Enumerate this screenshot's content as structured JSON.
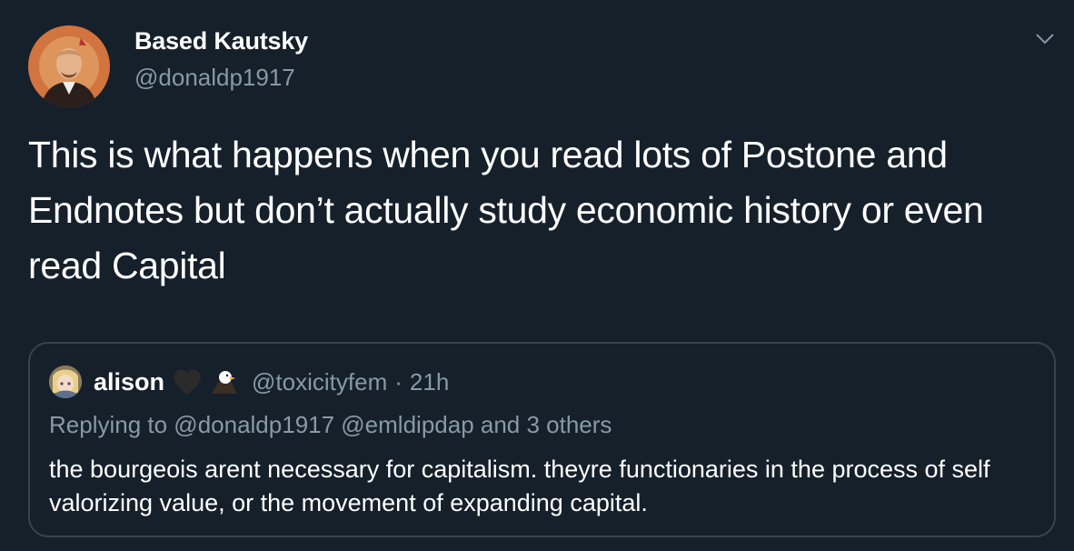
{
  "tweet": {
    "author": {
      "display_name": "Based Kautsky",
      "handle": "@donaldp1917",
      "avatar_icon": "portrait-avatar"
    },
    "text": "This is what happens when you read lots of Postone and Endnotes but don’t actually study economic history or even read Capital",
    "menu_icon": "chevron-down-icon"
  },
  "quoted_tweet": {
    "display_name": "alison",
    "name_emojis": [
      "black-heart-icon",
      "eagle-icon"
    ],
    "handle": "@toxicityfem",
    "separator": "·",
    "time": "21h",
    "replying_to": "Replying to @donaldp1917 @emldipdap and 3 others",
    "text": "the bourgeois arent necessary for capitalism. theyre functionaries in the process of self valorizing value, or the movement of expanding capital."
  },
  "colors": {
    "background": "#15202b",
    "primary_text": "#ffffff",
    "secondary_text": "#8899a6",
    "border": "#38444d"
  }
}
